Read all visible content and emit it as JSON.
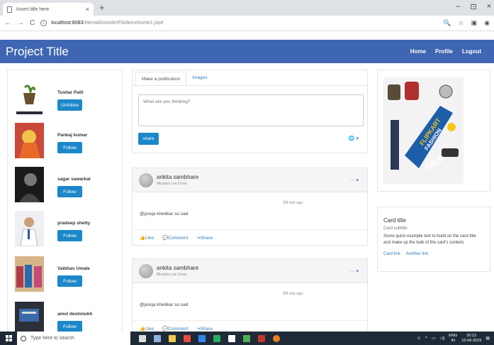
{
  "browser": {
    "tab_title": "Insert title here",
    "tab_close": "×",
    "new_tab": "+",
    "window_controls": [
      "–",
      "⊡",
      "×"
    ],
    "nav": [
      "←",
      "→",
      "C"
    ],
    "url_host": "localhost:8083",
    "url_path": "/MentalDisorderFb/demohome1.jsp#",
    "toolbar_icons": [
      "zoom-icon",
      "star-icon",
      "extension-icon",
      "account-icon"
    ]
  },
  "navbar": {
    "brand": "Project Title",
    "links": [
      "Home",
      "Profile",
      "Logout"
    ],
    "color": "#3f66b2"
  },
  "follow_list": [
    {
      "name": "Tushar Patil",
      "button": "Unfollow"
    },
    {
      "name": "Pankaj kumar",
      "button": "Follow"
    },
    {
      "name": "sagar sawarkar",
      "button": "Follow"
    },
    {
      "name": "pradeep shetty",
      "button": "Follow"
    },
    {
      "name": "Vaibhav Umale",
      "button": "Follow"
    },
    {
      "name": "amol deshmukh",
      "button": "Follow"
    }
  ],
  "composer": {
    "tabs": [
      "Make a publication",
      "Images"
    ],
    "placeholder": "What are you thinking?",
    "share_label": "share",
    "privacy_icon": "🌐 ▾"
  },
  "posts": [
    {
      "author": "ankita sambhare",
      "subtitle": "Miracles Lee Cross",
      "time": "⏱8 min ago",
      "text": "@pooja khedkar so sad",
      "actions": [
        "👍Like",
        "💬Comment",
        "↪Share"
      ],
      "menu": "··· ▾"
    },
    {
      "author": "ankita sambhare",
      "subtitle": "Miracles Lee Cross",
      "time": "⏱8 min ago",
      "text": "@pooja khedkar so sad",
      "actions": [
        "👍Like",
        "💬Comment",
        "↪Share"
      ],
      "menu": "··· ▾"
    }
  ],
  "side_card": {
    "title": "Card title",
    "subtitle": "Card subtitle",
    "text": "Some quick example text to build on the card title and make up the bulk of the card's content.",
    "links": [
      "Card link",
      "Another link"
    ]
  },
  "ad": {
    "text1": "FLIPKART",
    "text2": "FASHION",
    "text3": "SALE"
  },
  "taskbar": {
    "search_placeholder": "Type here to search",
    "lang": "ENG",
    "lang2": "IN",
    "time": "20:12",
    "date": "15-06-2019"
  }
}
